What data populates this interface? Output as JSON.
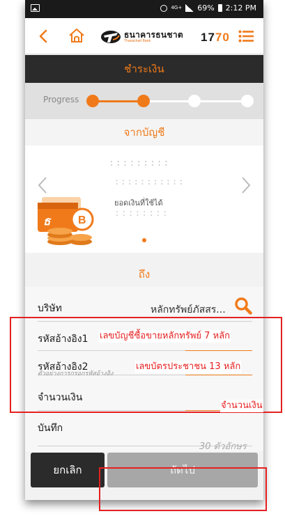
{
  "status_bar": {
    "network": "4G+",
    "battery": "69%",
    "time": "2:12 PM"
  },
  "header": {
    "brand_th": "ธนาคารธนชาต",
    "brand_en": "Thanachart Bank",
    "hotline_prefix": "17",
    "hotline_accent": "70"
  },
  "title": "ชำระเงิน",
  "progress": {
    "label": "Progress",
    "completed_steps": 2,
    "total_steps": 4
  },
  "account": {
    "heading": "จากบัญชี",
    "number_masked": ":::::::::",
    "name_masked": ":::::::::::",
    "balance_label": "ยอดเงินที่ใช้ได้",
    "balance_masked": "::::::::",
    "active_page": 1
  },
  "to": {
    "heading": "ถึง"
  },
  "form": {
    "company_label": "บริษัท",
    "company_value": "หลักทรัพย์ภัสสร...",
    "ref1_label": "รหัสอ้างอิง1",
    "ref2_label": "รหัสอ้างอิง2",
    "ref_hint": "ตัวอย่างการกรอกรหัสอ้างอิง",
    "amount_label": "จำนวนเงิน",
    "note_label": "บันทึก",
    "note_placeholder": "30 ตัวอักษร"
  },
  "buttons": {
    "cancel": "ยกเลิก",
    "next": "ถัดไป"
  },
  "annotations": {
    "ref1_note": "เลขบัญชีซื้อขายหลักทรัพย์ 7 หลัก",
    "ref2_note": "เลขบัตรประชาชน 13 หลัก",
    "amount_note": "จำนวนเงิน"
  },
  "colors": {
    "accent": "#f07a1a",
    "title_bar": "#2b2b2b",
    "annotation": "#e52020"
  }
}
